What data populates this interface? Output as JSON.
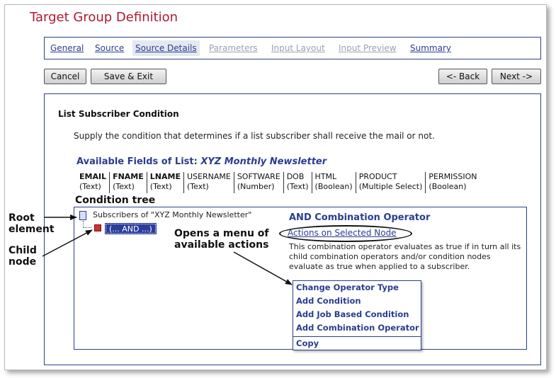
{
  "page": {
    "title": "Target Group Definition"
  },
  "tabs": [
    {
      "label": "General",
      "state": "active"
    },
    {
      "label": "Source",
      "state": "active"
    },
    {
      "label": "Source Details",
      "state": "current"
    },
    {
      "label": "Parameters",
      "state": "disabled"
    },
    {
      "label": "Input Layout",
      "state": "disabled"
    },
    {
      "label": "Input Preview",
      "state": "disabled"
    },
    {
      "label": "Summary",
      "state": "active"
    }
  ],
  "buttons": {
    "cancel": "Cancel",
    "save_exit": "Save & Exit",
    "back": "<- Back",
    "next": "Next ->"
  },
  "condition": {
    "title": "List Subscriber Condition",
    "description": "Supply the condition that determines if a list subscriber shall receive the mail or not.",
    "available_prefix": "Available Fields of List: ",
    "list_name": "XYZ Monthly Newsletter",
    "fields": [
      {
        "name": "EMAIL",
        "type": "(Text)",
        "bold": true
      },
      {
        "name": "FNAME",
        "type": "(Text)",
        "bold": true
      },
      {
        "name": "LNAME",
        "type": "(Text)",
        "bold": true
      },
      {
        "name": "USERNAME",
        "type": "(Text)",
        "bold": false
      },
      {
        "name": "SOFTWARE",
        "type": "(Number)",
        "bold": false
      },
      {
        "name": "DOB",
        "type": "(Text)",
        "bold": false
      },
      {
        "name": "HTML",
        "type": "(Boolean)",
        "bold": false
      },
      {
        "name": "PRODUCT",
        "type": "(Multiple Select)",
        "bold": false
      },
      {
        "name": "PERMISSION",
        "type": "(Boolean)",
        "bold": false
      }
    ]
  },
  "tree": {
    "label": "Condition tree",
    "root_text": "Subscribers of \"XYZ Monthly Newsletter\"",
    "child_text": "(... AND ...)",
    "operator_title": "AND Combination Operator",
    "actions_link": "Actions on Selected Node",
    "operator_desc": "This combination operator evaluates as true if in turn all its child combination operators and/or condition nodes evaluate as true when applied to a subscriber."
  },
  "menu": [
    {
      "label": "Change Operator Type"
    },
    {
      "label": "Add Condition"
    },
    {
      "label": "Add Job Based Condition"
    },
    {
      "label": "Add Combination Operator"
    },
    {
      "label": "Copy"
    }
  ],
  "annotations": {
    "root": "Root element",
    "child": "Child node",
    "menu": "Opens a menu of available actions"
  },
  "colors": {
    "title": "#b01830",
    "accent": "#2a3d8f",
    "disabled_tab": "#9aa0b6",
    "child_node_bg": "#2a3d9a",
    "child_icon": "#d03030"
  }
}
